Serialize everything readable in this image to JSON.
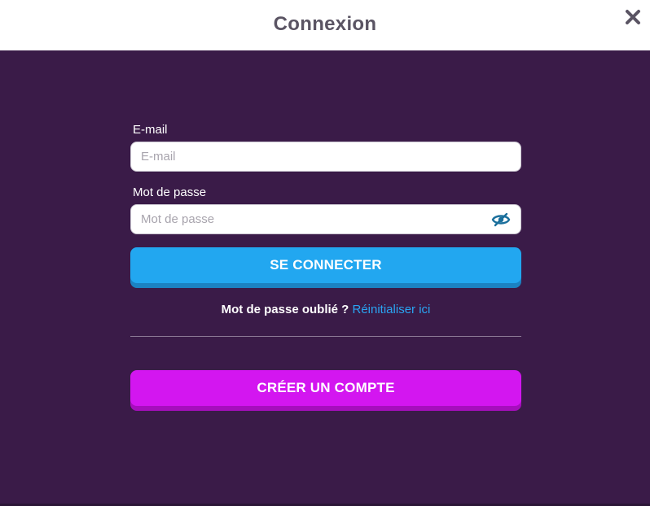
{
  "modal": {
    "title": "Connexion",
    "close_icon": "close-icon"
  },
  "form": {
    "email": {
      "label": "E-mail",
      "placeholder": "E-mail",
      "value": ""
    },
    "password": {
      "label": "Mot de passe",
      "placeholder": "Mot de passe",
      "value": "",
      "toggle_icon": "eye-off-icon"
    },
    "login_button": "SE CONNECTER",
    "forgot": {
      "text": "Mot de passe oublié ?",
      "link": "Réinitialiser ici"
    },
    "register_button": "CRÉER UN COMPTE"
  },
  "colors": {
    "background": "#3a1b48",
    "header": "#ffffff",
    "login_button": "#22a7f0",
    "register_button": "#d316f0",
    "link": "#2aa5f2",
    "eye_icon": "#1a6f9c"
  }
}
